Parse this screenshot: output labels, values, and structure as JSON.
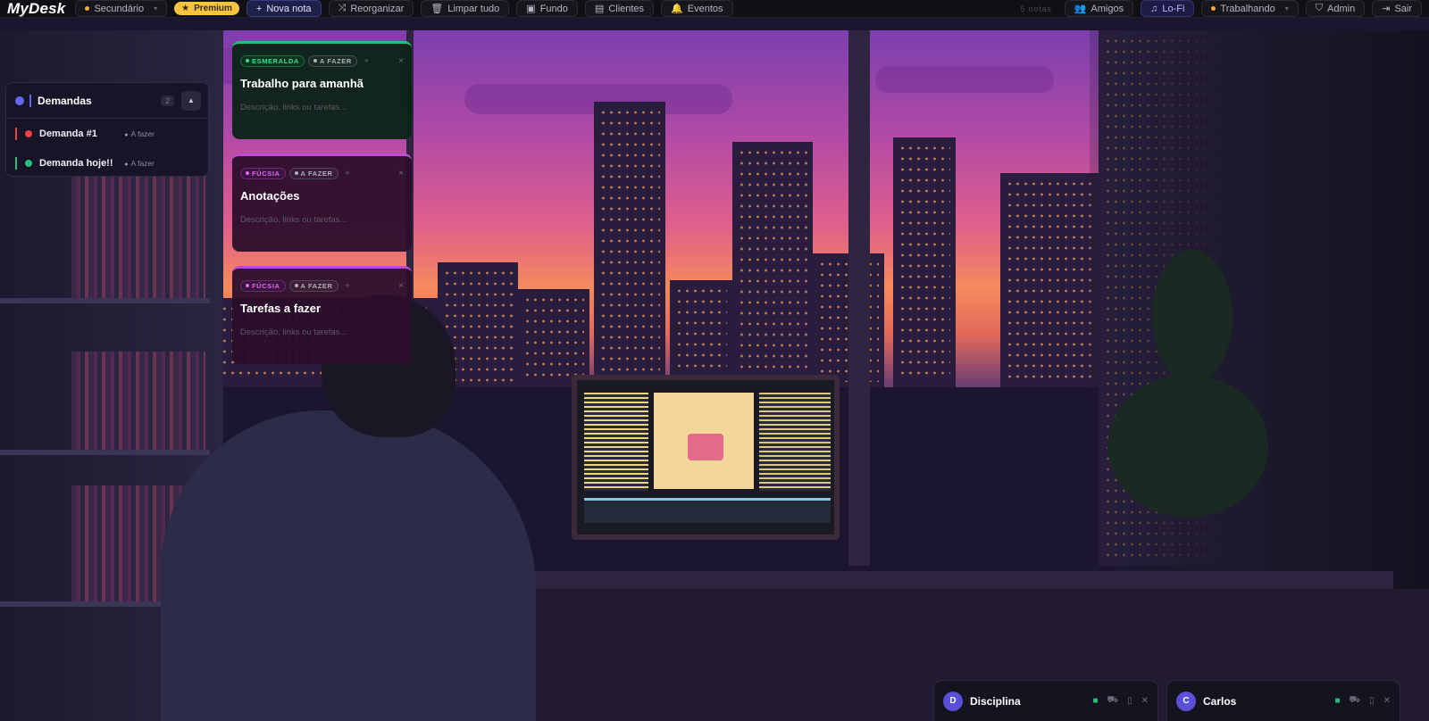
{
  "app": {
    "logo": "MyDesk"
  },
  "toolbar": {
    "workspace_label": "Secundário",
    "premium_label": "Premium",
    "new_note_label": "Nova nota",
    "reorganize_label": "Reorganizar",
    "clear_label": "Limpar tudo",
    "background_label": "Fundo",
    "clients_label": "Clientes",
    "events_label": "Eventos",
    "notes_count": "5 notas",
    "friends_label": "Amigos",
    "music_label": "Lo-Fi",
    "status_label": "Trabalhando",
    "admin_label": "Admin",
    "logout_label": "Sair",
    "icons": {
      "new_note": "plus-icon",
      "reorganize": "shuffle-icon",
      "clear": "trash-icon",
      "background": "image-icon",
      "clients": "table-icon",
      "events": "bell-icon",
      "friends": "users-icon",
      "music": "music-note-icon",
      "admin": "shield-icon",
      "logout": "logout-icon"
    },
    "colors": {
      "premium": "#f5c542",
      "status_dot": "#f2a93b",
      "accent": "#6468f0"
    }
  },
  "demandas": {
    "title": "Demandas",
    "count": "2",
    "items": [
      {
        "label": "Demanda #1",
        "status": "A fazer",
        "color": "#ef4444"
      },
      {
        "label": "Demanda hoje!!",
        "status": "A fazer",
        "color": "#22c27a"
      }
    ]
  },
  "notes": [
    {
      "color_tag": "ESMERALDA",
      "status_tag": "A FAZER",
      "title": "Trabalho para amanhã",
      "placeholder": "Descrição, links ou tarefas...",
      "color": "#22c27a"
    },
    {
      "color_tag": "FÚCSIA",
      "status_tag": "A FAZER",
      "title": "Anotações",
      "placeholder": "Descrição, links ou tarefas...",
      "color": "#c04ad6"
    },
    {
      "color_tag": "FÚCSIA",
      "status_tag": "A FAZER",
      "title": "Tarefas a fazer",
      "placeholder": "Descrição, links ou tarefas...",
      "color": "#c04ad6"
    }
  ],
  "chats": [
    {
      "initial": "D",
      "name": "Disciplina"
    },
    {
      "initial": "C",
      "name": "Carlos"
    }
  ]
}
